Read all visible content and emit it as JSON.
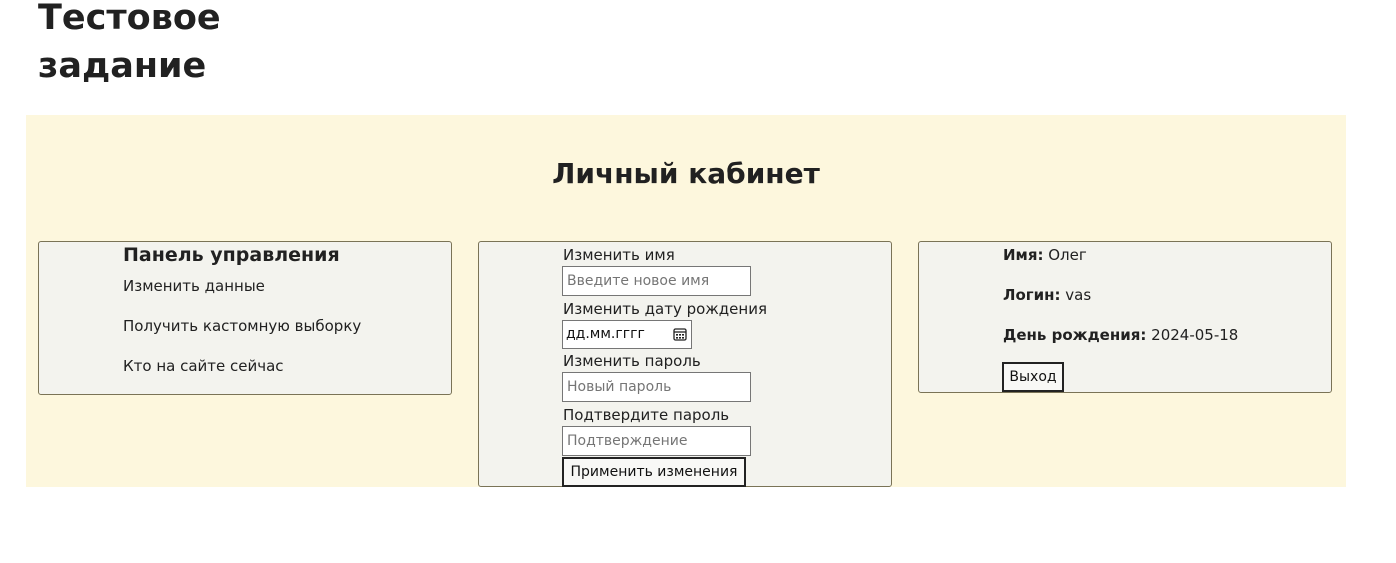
{
  "site_title": "Тестовое задание",
  "account_title": "Личный кабинет",
  "control_panel": {
    "heading": "Панель управления",
    "links": [
      "Изменить данные",
      "Получить кастомную выборку",
      "Кто на сайте сейчас"
    ]
  },
  "edit_form": {
    "name_label": "Изменить имя",
    "name_placeholder": "Введите новое имя",
    "birthdate_label": "Изменить дату рождения",
    "birthdate_placeholder": "дд.мм.гггг",
    "password_label": "Изменить пароль",
    "password_placeholder": "Новый пароль",
    "confirm_label": "Подтвердите пароль",
    "confirm_placeholder": "Подтверждение",
    "apply_label": "Применить изменения"
  },
  "profile": {
    "name_label": "Имя:",
    "name_value": "Олег",
    "login_label": "Логин:",
    "login_value": "vas",
    "birthday_label": "День рождения:",
    "birthday_value": "2024-05-18",
    "logout_label": "Выход"
  },
  "colors": {
    "section_bg": "#fdf7dd",
    "panel_bg": "#f3f3ee",
    "panel_border": "#7a7356"
  },
  "icons": {
    "calendar": "calendar-icon"
  }
}
